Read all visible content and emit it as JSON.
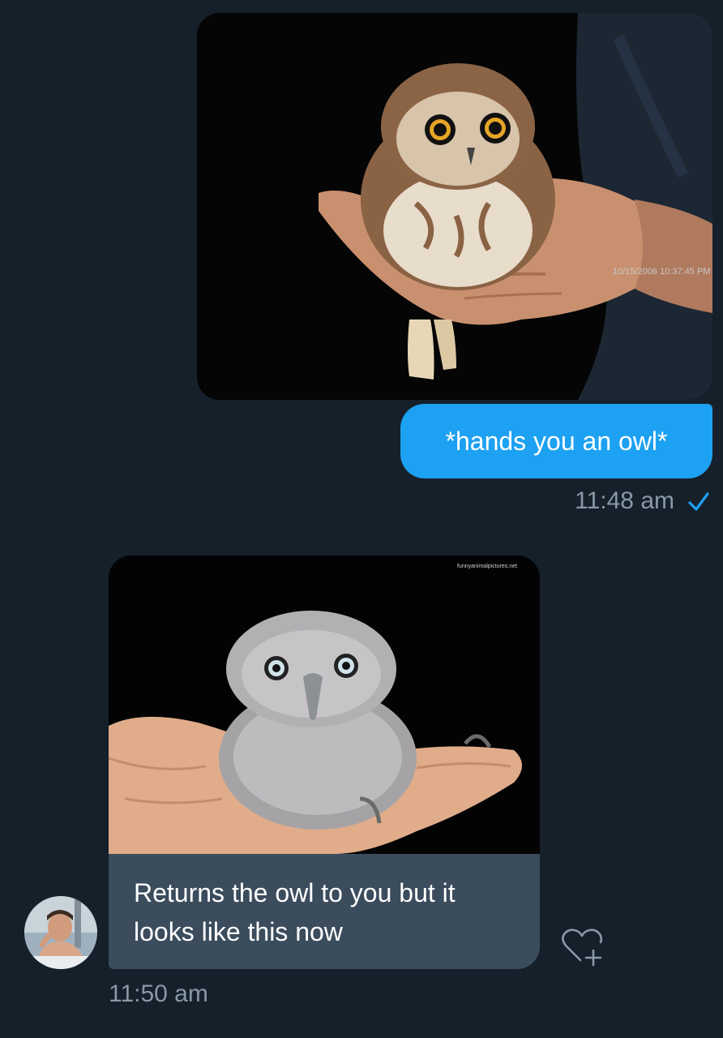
{
  "conversation": {
    "outgoing": {
      "image": {
        "alt": "owl-in-hand-photo",
        "timestamp_overlay": "10/15/2006 10:37:45 PM"
      },
      "text": "*hands you an owl*",
      "time": "11:48 am",
      "status_icon": "read-check-icon"
    },
    "incoming": {
      "image": {
        "alt": "fluffy-baby-owl-photo",
        "watermark": "funnyanimalpictures.net"
      },
      "text": "Returns the owl to you but it looks like this now",
      "time": "11:50 am",
      "avatar_icon": "user-avatar",
      "reaction_icon": "heart-plus-icon"
    }
  },
  "colors": {
    "background": "#15202b",
    "outgoing_bubble": "#1da1f2",
    "incoming_bubble": "#3b4c5d",
    "timestamp": "#8899a6"
  }
}
